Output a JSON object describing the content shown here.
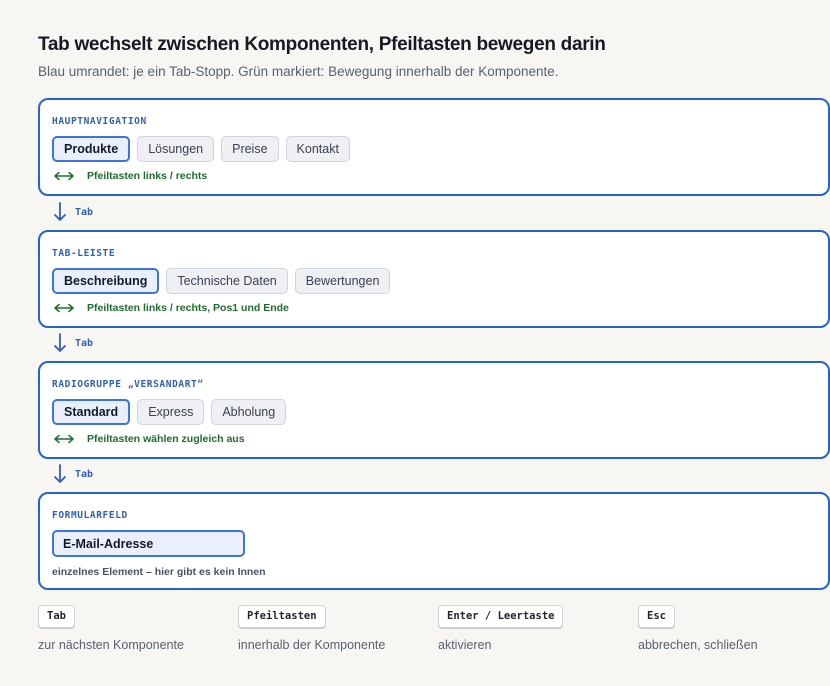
{
  "header": {
    "title": "Tab wechselt zwischen Komponenten, Pfeiltasten bewegen darin",
    "subtitle": "Blau umrandet: je ein Tab-Stopp. Grün markiert: Bewegung innerhalb der Komponente."
  },
  "colors": {
    "tab_stop_border": "#2563d0",
    "arrow_hint_green": "#1d6e2d",
    "active_fill": "#e9f0fc"
  },
  "components": {
    "nav": {
      "label": "HAUPTNAVIGATION",
      "items": [
        "Produkte",
        "Lösungen",
        "Preise",
        "Kontakt"
      ],
      "hint": "Pfeiltasten links / rechts"
    },
    "tabs": {
      "label": "TAB-LEISTE",
      "items": [
        "Beschreibung",
        "Technische Daten",
        "Bewertungen"
      ],
      "hint": "Pfeiltasten links / rechts, Pos1 und Ende"
    },
    "radio": {
      "label": "RADIOGRUPPE „VERSANDART“",
      "items": [
        "Standard",
        "Express",
        "Abholung"
      ],
      "hint": "Pfeiltasten wählen zugleich aus"
    },
    "form": {
      "label": "FORMULARFELD",
      "field_value": "E-Mail-Adresse",
      "note": "einzelnes Element – hier gibt es kein Innen"
    }
  },
  "connector_label": "Tab",
  "legend": [
    {
      "key": "Tab",
      "desc": "zur nächsten Komponente"
    },
    {
      "key": "Pfeiltasten",
      "desc": "innerhalb der Komponente"
    },
    {
      "key": "Enter / Leertaste",
      "desc": "aktivieren"
    },
    {
      "key": "Esc",
      "desc": "abbrechen, schließen"
    }
  ]
}
